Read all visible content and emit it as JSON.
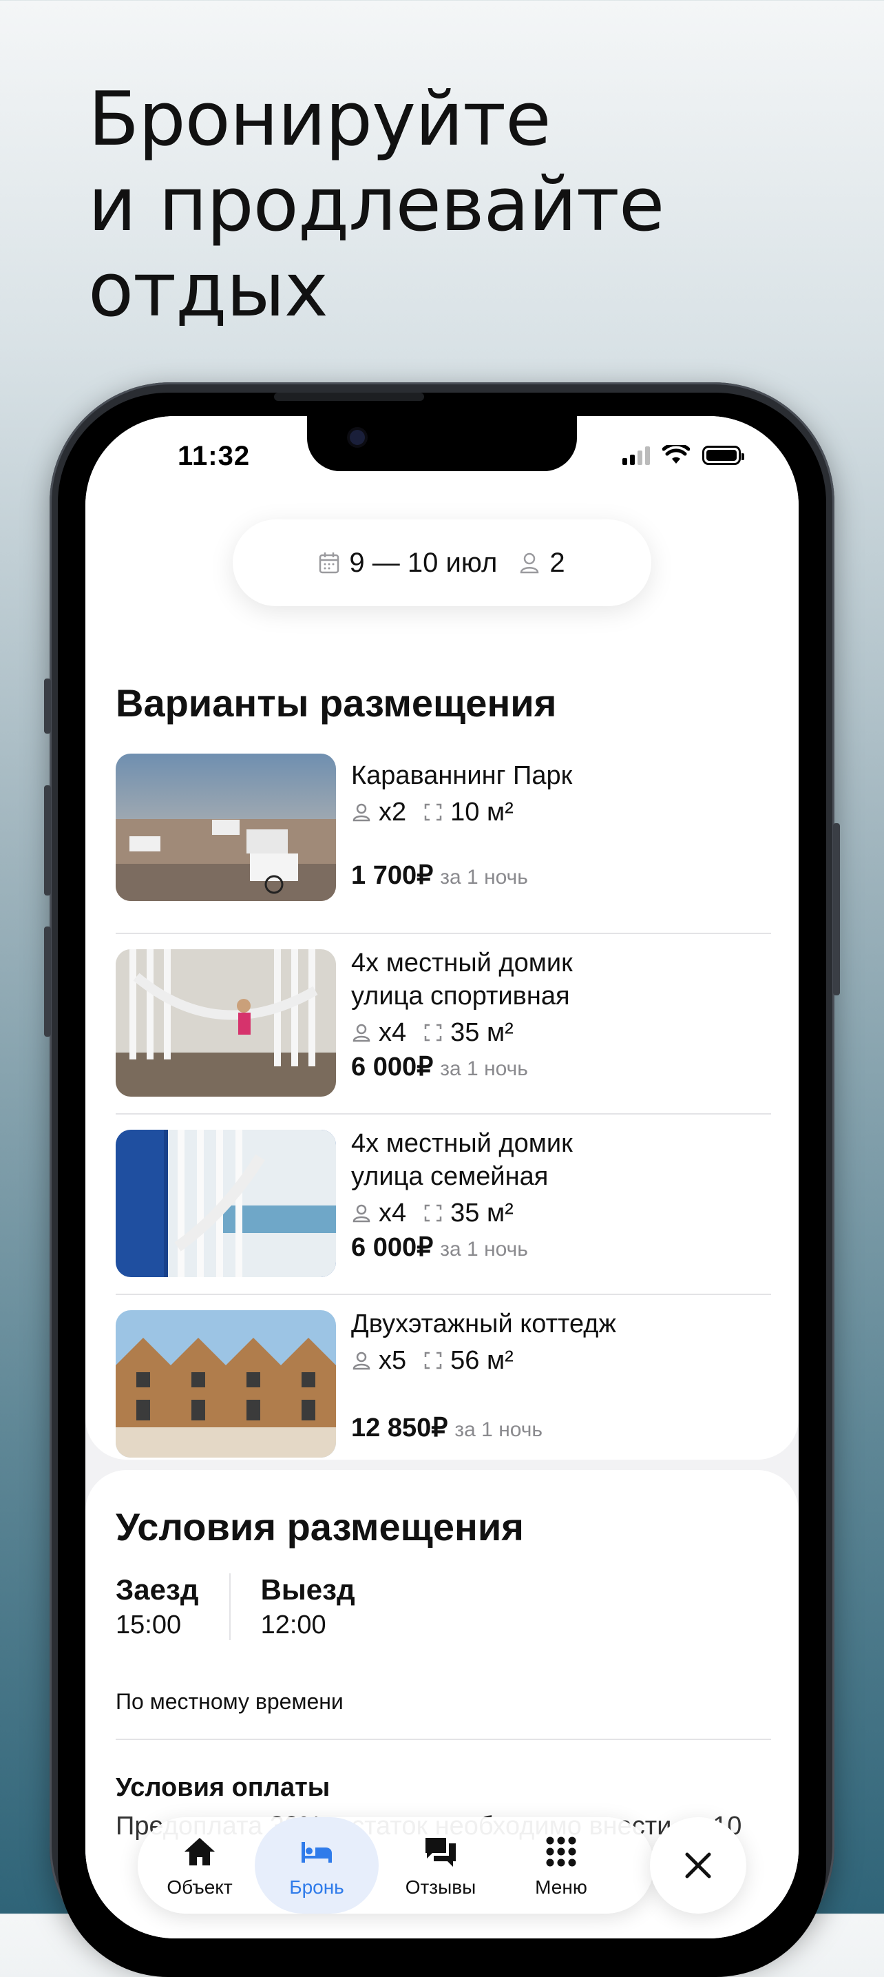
{
  "headline": {
    "line1": "Бронируйте",
    "line2": "и продлевайте",
    "line3": "отдых"
  },
  "status_bar": {
    "time": "11:32"
  },
  "search": {
    "dates": "9 — 10 июл",
    "guests": "2"
  },
  "listings_section": {
    "title": "Варианты размещения",
    "items": [
      {
        "name": "Караваннинг Парк",
        "guests": "x2",
        "area": "10 м²",
        "price": "1 700₽",
        "per": "за 1 ночь"
      },
      {
        "name": "4х местный домик улица спортивная",
        "guests": "x4",
        "area": "35 м²",
        "price": "6 000₽",
        "per": "за 1 ночь"
      },
      {
        "name": "4х местный домик улица семейная",
        "guests": "x4",
        "area": "35 м²",
        "price": "6 000₽",
        "per": "за 1 ночь"
      },
      {
        "name": "Двухэтажный коттедж",
        "guests": "x5",
        "area": "56 м²",
        "price": "12 850₽",
        "per": "за 1 ночь"
      }
    ]
  },
  "conditions": {
    "title": "Условия размещения",
    "checkin_label": "Заезд",
    "checkin_time": "15:00",
    "checkout_label": "Выезд",
    "checkout_time": "12:00",
    "timezone_note": "По местному времени",
    "payment_title": "Условия оплаты",
    "payment_text": "Предоплата 30%, остаток необходимо внести за 10"
  },
  "tabbar": {
    "tabs": [
      {
        "label": "Объект",
        "icon": "home-icon"
      },
      {
        "label": "Бронь",
        "icon": "bed-icon",
        "active": true
      },
      {
        "label": "Отзывы",
        "icon": "reviews-icon"
      },
      {
        "label": "Меню",
        "icon": "grid-menu-icon"
      }
    ],
    "close_icon": "close-icon"
  },
  "colors": {
    "accent": "#2f7bea",
    "text": "#111111",
    "muted": "#8a8a8e"
  }
}
